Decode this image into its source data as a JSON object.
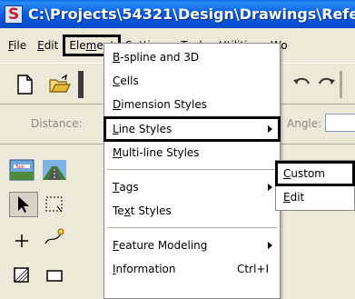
{
  "window": {
    "title": "C:\\Projects\\54321\\Design\\Drawings\\Refe"
  },
  "menubar": {
    "items": [
      {
        "label": "File",
        "underline": "F"
      },
      {
        "label": "Edit",
        "underline": "E"
      },
      {
        "label": "Element",
        "underline": "m"
      },
      {
        "label": "Settings",
        "underline": "S"
      },
      {
        "label": "Tools",
        "underline": "T"
      },
      {
        "label": "Utilities",
        "underline": "U"
      },
      {
        "label": "Wo",
        "underline": ""
      }
    ]
  },
  "toolbar": {
    "distance_label": "Distance:",
    "angle_label": "Angle:"
  },
  "element_menu": {
    "items": [
      {
        "label": "B-spline and 3D",
        "submenu": false,
        "shortcut": ""
      },
      {
        "label": "Cells",
        "submenu": false,
        "shortcut": ""
      },
      {
        "label": "Dimension Styles",
        "submenu": false,
        "shortcut": ""
      },
      {
        "label": "Line Styles",
        "submenu": true,
        "shortcut": ""
      },
      {
        "label": "Multi-line Styles",
        "submenu": false,
        "shortcut": ""
      },
      {
        "label": "Tags",
        "submenu": true,
        "shortcut": ""
      },
      {
        "label": "Text Styles",
        "submenu": false,
        "shortcut": ""
      },
      {
        "label": "Feature Modeling",
        "submenu": true,
        "shortcut": ""
      },
      {
        "label": "Information",
        "submenu": false,
        "shortcut": "Ctrl+I"
      }
    ]
  },
  "line_styles_submenu": {
    "items": [
      {
        "label": "Custom"
      },
      {
        "label": "Edit"
      }
    ]
  },
  "icons": {
    "app": "microstation-app-icon",
    "new": "new-file-icon",
    "open": "open-folder-icon",
    "undo": "undo-icon",
    "redo": "redo-icon",
    "place_smartline": "place-smartline-icon",
    "road": "road-icon",
    "select": "select-arrow-icon",
    "fence": "fence-icon",
    "point": "point-icon",
    "modify": "modify-icon",
    "shape": "shape-icon",
    "rectangle": "rectangle-icon"
  },
  "colors": {
    "titlebar": "#0550d6",
    "menu_bg": "#ece9d8",
    "highlight_border": "#000000"
  }
}
